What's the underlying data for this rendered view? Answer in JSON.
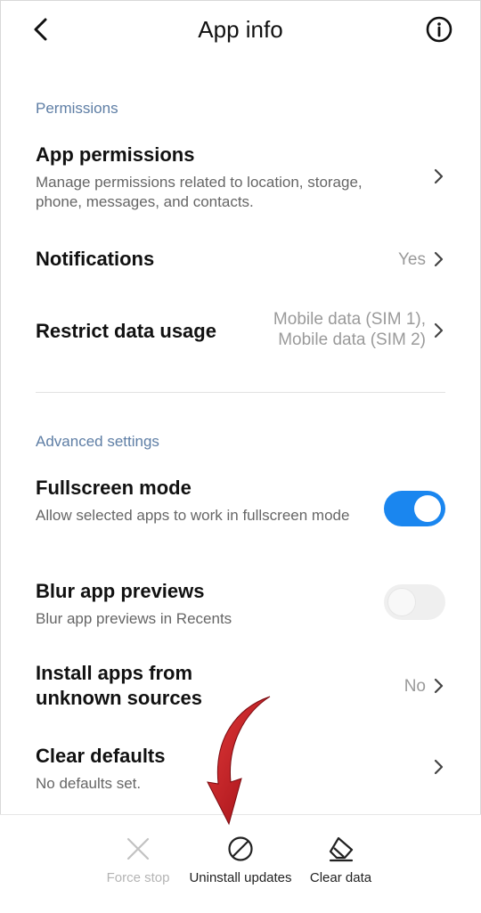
{
  "header": {
    "title": "App info",
    "back_icon": "chevron-left-icon",
    "info_icon": "info-circle-icon"
  },
  "permissions_section": {
    "label": "Permissions",
    "app_permissions": {
      "title": "App permissions",
      "description": "Manage permissions related to location, storage, phone, messages, and contacts."
    },
    "notifications": {
      "title": "Notifications",
      "value": "Yes"
    },
    "restrict_data": {
      "title": "Restrict data usage",
      "value_line1": "Mobile data (SIM 1),",
      "value_line2": "Mobile data (SIM 2)"
    }
  },
  "advanced_section": {
    "label": "Advanced settings",
    "fullscreen": {
      "title": "Fullscreen mode",
      "description": "Allow selected apps to work in fullscreen mode",
      "enabled": true
    },
    "blur": {
      "title": "Blur app previews",
      "description": "Blur app previews in Recents",
      "enabled": false
    },
    "unknown_sources": {
      "title_line1": "Install apps from",
      "title_line2": "unknown sources",
      "value": "No"
    },
    "clear_defaults": {
      "title": "Clear defaults",
      "description": "No defaults set."
    }
  },
  "bottom_bar": {
    "force_stop": {
      "label": "Force stop",
      "icon": "close-x-icon",
      "enabled": false
    },
    "uninstall_updates": {
      "label": "Uninstall updates",
      "icon": "prohibit-icon",
      "enabled": true
    },
    "clear_data": {
      "label": "Clear data",
      "icon": "eraser-icon",
      "enabled": true
    }
  },
  "colors": {
    "accent": "#1a86ef",
    "section_label": "#5e7ea5",
    "annotation_arrow": "#c0121b"
  }
}
